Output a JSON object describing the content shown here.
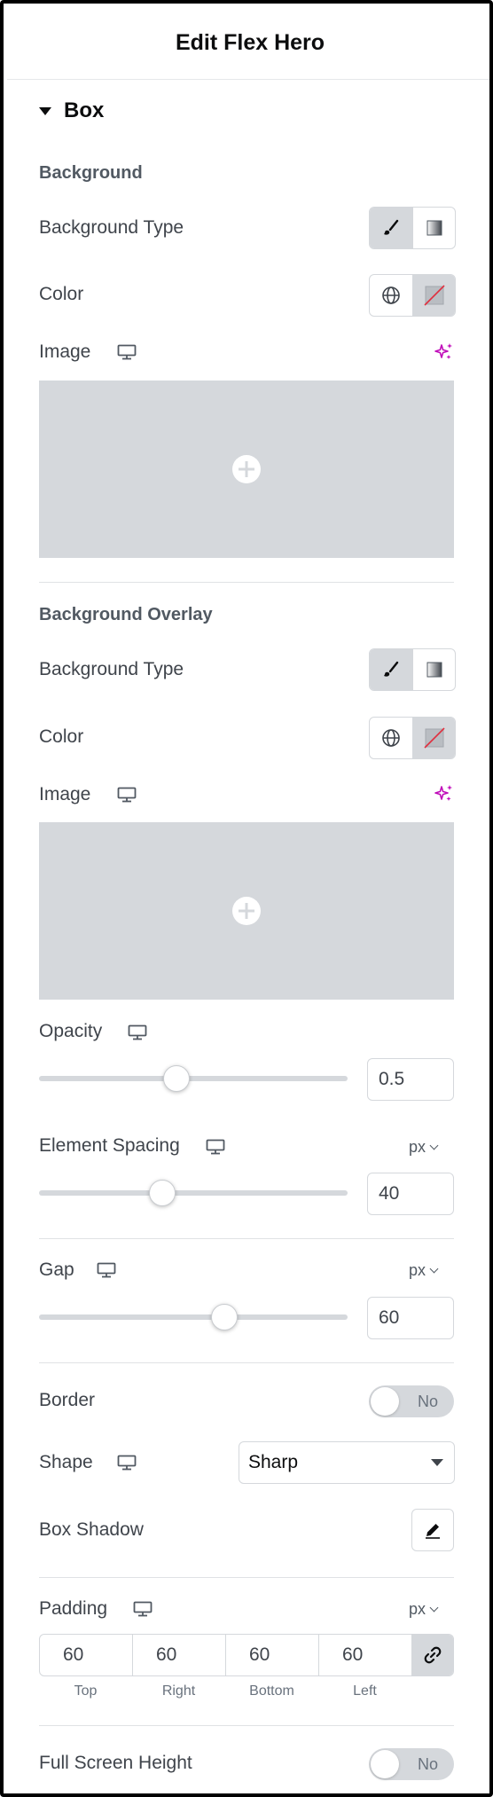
{
  "header": {
    "title": "Edit Flex Hero"
  },
  "section": {
    "title": "Box",
    "caret_icon": "caret-down-icon"
  },
  "background": {
    "title": "Background",
    "type_label": "Background Type",
    "type_options": [
      "classic-brush-icon",
      "gradient-icon"
    ],
    "type_selected": "classic",
    "color_label": "Color",
    "image_label": "Image",
    "ai_icon": "ai-sparkle-icon"
  },
  "overlay": {
    "title": "Background Overlay",
    "type_label": "Background Type",
    "type_options": [
      "classic-brush-icon",
      "gradient-icon"
    ],
    "type_selected": "classic",
    "color_label": "Color",
    "image_label": "Image",
    "ai_icon": "ai-sparkle-icon"
  },
  "opacity": {
    "label": "Opacity",
    "value": "0.5",
    "slider_fraction": 0.445
  },
  "element_spacing": {
    "label": "Element Spacing",
    "unit": "px",
    "value": "40",
    "slider_fraction": 0.4
  },
  "gap": {
    "label": "Gap",
    "unit": "px",
    "value": "60",
    "slider_fraction": 0.6
  },
  "border": {
    "label": "Border",
    "toggle_text": "No"
  },
  "shape": {
    "label": "Shape",
    "selected": "Sharp"
  },
  "box_shadow": {
    "label": "Box Shadow",
    "icon": "pencil-edit-icon"
  },
  "padding": {
    "label": "Padding",
    "unit": "px",
    "top": "60",
    "right": "60",
    "bottom": "60",
    "left": "60",
    "labels": {
      "top": "Top",
      "right": "Right",
      "bottom": "Bottom",
      "left": "Left"
    },
    "link_icon": "link-icon"
  },
  "full_screen": {
    "label": "Full Screen Height",
    "toggle_text": "No"
  },
  "colors": {
    "accent_ai": "#c00bb9",
    "control_bg": "#d5d8dc",
    "text": "#3f444b"
  }
}
